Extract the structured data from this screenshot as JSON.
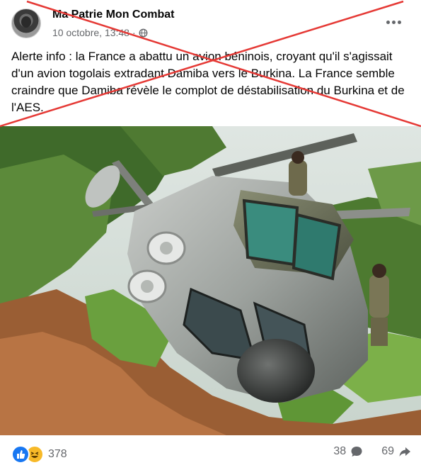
{
  "post": {
    "author": "Ma Patrie Mon Combat",
    "date": "10 octobre, 13:48",
    "separator": "·",
    "text": "Alerte info : la France a abattu un avion béninois, croyant qu'il s'agissait d'un avion togolais extradant Damiba vers le Burkina. La France semble craindre que Damiba révèle le complot de déstabilisation du Burkina et de l'AES.",
    "reaction_count": "378",
    "comment_count": "38",
    "share_count": "69"
  },
  "icons": {
    "privacy": "globe-icon",
    "menu": "more-options-icon",
    "reaction_1": "like-icon",
    "reaction_2": "haha-icon",
    "comments": "comment-icon",
    "shares": "share-icon"
  },
  "colors": {
    "cross_out": "#e53935",
    "like": "#1877f2",
    "haha": "#f7b928",
    "secondary_text": "#65676b"
  }
}
